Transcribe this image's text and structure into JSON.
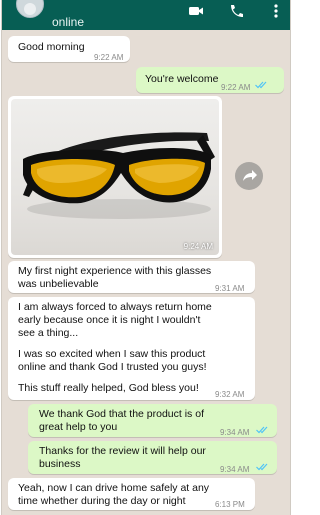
{
  "header": {
    "status": "online",
    "icons": [
      "avatar",
      "video-call-icon",
      "phone-call-icon",
      "more-vert-icon"
    ]
  },
  "messages": [
    {
      "dir": "in",
      "text": "Good morning",
      "time": "9:22 AM"
    },
    {
      "dir": "out",
      "text": "You're welcome",
      "time": "9:22 AM",
      "read": true
    },
    {
      "dir": "in",
      "type": "image",
      "alt": "yellow night-driving glasses",
      "time": "9:24 AM"
    },
    {
      "dir": "in",
      "lines": [
        "My first night experience with this glasses",
        "was unbelievable"
      ],
      "time": "9:31 AM"
    },
    {
      "dir": "in",
      "lines": [
        "I am always forced to always return home",
        "early because once it is night I wouldn't",
        "see a thing...",
        "",
        "I was so excited when I saw this product",
        "online and thank God I trusted you guys!",
        "",
        "This stuff really helped, God bless you!"
      ],
      "time": "9:32 AM"
    },
    {
      "dir": "out",
      "lines": [
        "We thank God that the product is of",
        "great help to you"
      ],
      "time": "9:34 AM",
      "read": true
    },
    {
      "dir": "out",
      "lines": [
        "Thanks for the review it will help our",
        "business"
      ],
      "time": "9:34 AM",
      "read": true
    },
    {
      "dir": "in",
      "lines": [
        "Yeah, now I can drive home safely at any",
        "time whether during the day or night"
      ],
      "time": "6:13 PM"
    }
  ],
  "colors": {
    "header": "#075e54",
    "chat_bg": "#e5ddd5",
    "incoming": "#ffffff",
    "outgoing": "#dcf8c6",
    "read_tick": "#4fc3f7"
  }
}
